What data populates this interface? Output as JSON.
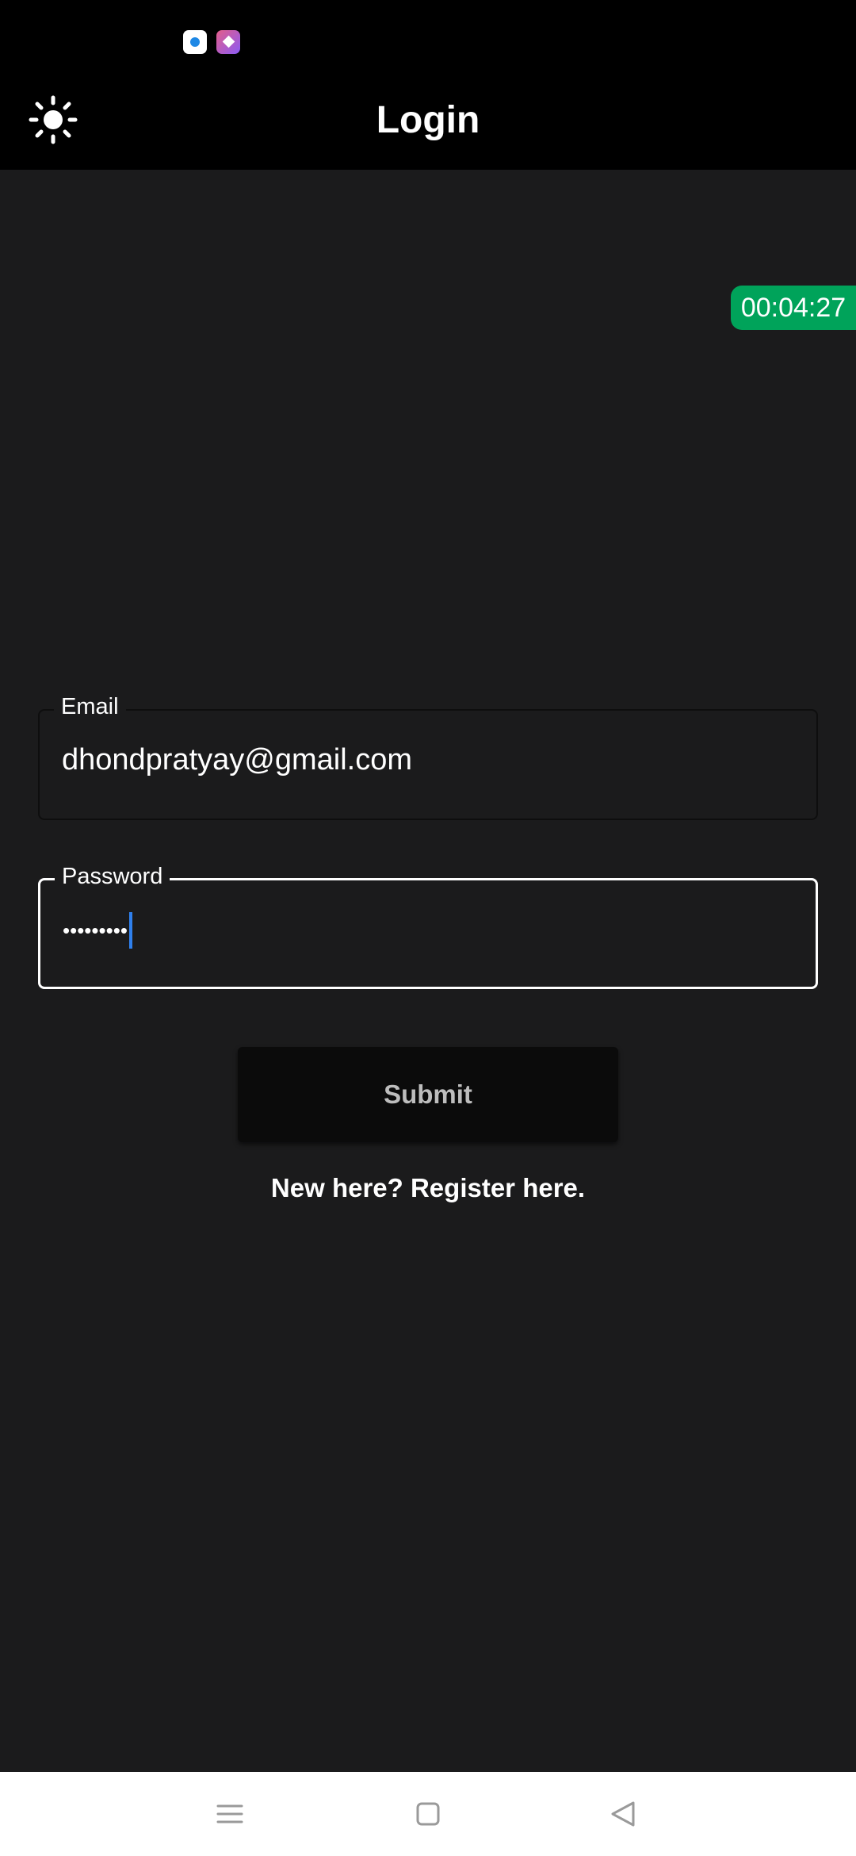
{
  "status_bar": {
    "notification_icons": [
      "circle-app-icon",
      "pencil-app-icon"
    ]
  },
  "app_bar": {
    "title": "Login",
    "theme_icon": "sun-icon"
  },
  "timer": {
    "value": "00:04:27",
    "color": "#00a35a"
  },
  "form": {
    "email": {
      "label": "Email",
      "value": "dhondpratyay@gmail.com"
    },
    "password": {
      "label": "Password",
      "masked_value": "•••••••••"
    },
    "submit_label": "Submit",
    "register_text": "New here? Register here."
  },
  "nav_bar": {
    "icons": [
      "menu-icon",
      "home-square-icon",
      "back-triangle-icon"
    ]
  },
  "colors": {
    "background": "#1b1b1c",
    "app_bar": "#000000",
    "accent_caret": "#2f80ed",
    "submit_text": "#bdbdbd"
  }
}
